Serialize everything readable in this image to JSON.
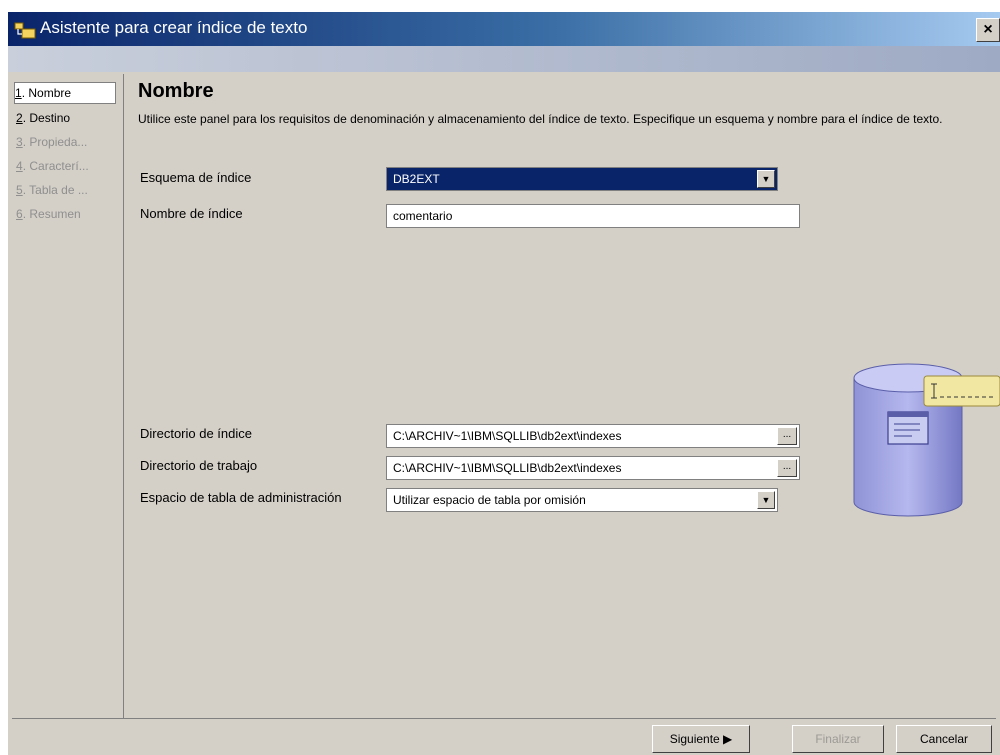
{
  "window": {
    "title": "Asistente para crear índice de texto",
    "close_label": "×"
  },
  "steps": [
    {
      "label": "1. Nombre",
      "num": "1",
      "rest": ". Nombre",
      "state": "selected"
    },
    {
      "label": "2. Destino",
      "num": "2",
      "rest": ". Destino",
      "state": "active"
    },
    {
      "label": "3. Propieda...",
      "num": "3",
      "rest": ". Propieda...",
      "state": "disabled"
    },
    {
      "label": "4. Caracterí...",
      "num": "4",
      "rest": ". Caracterí...",
      "state": "disabled"
    },
    {
      "label": "5. Tabla de ...",
      "num": "5",
      "rest": ". Tabla de ...",
      "state": "disabled"
    },
    {
      "label": "6. Resumen",
      "num": "6",
      "rest": ". Resumen",
      "state": "disabled"
    }
  ],
  "panel": {
    "title": "Nombre",
    "description": "Utilice este panel para los requisitos de denominación y almacenamiento del índice de texto. Especifique un esquema y nombre para el índice de texto."
  },
  "form": {
    "schema_label": "Esquema de índice",
    "schema_value": "DB2EXT",
    "name_label": "Nombre de índice",
    "name_value": "comentario",
    "index_dir_label": "Directorio de índice",
    "index_dir_value": "C:\\ARCHIV~1\\IBM\\SQLLIB\\db2ext\\indexes",
    "work_dir_label": "Directorio de trabajo",
    "work_dir_value": "C:\\ARCHIV~1\\IBM\\SQLLIB\\db2ext\\indexes",
    "tablespace_label": "Espacio de tabla de administración",
    "tablespace_value": "Utilizar espacio de tabla por omisión",
    "browse_label": "..."
  },
  "buttons": {
    "next_label": "Siguiente ▶",
    "finish_label": "Finalizar",
    "cancel_label": "Cancelar"
  },
  "colors": {
    "title_gradient_start": "#0a246a",
    "selection": "#0a246a",
    "face": "#d4d0c8"
  }
}
